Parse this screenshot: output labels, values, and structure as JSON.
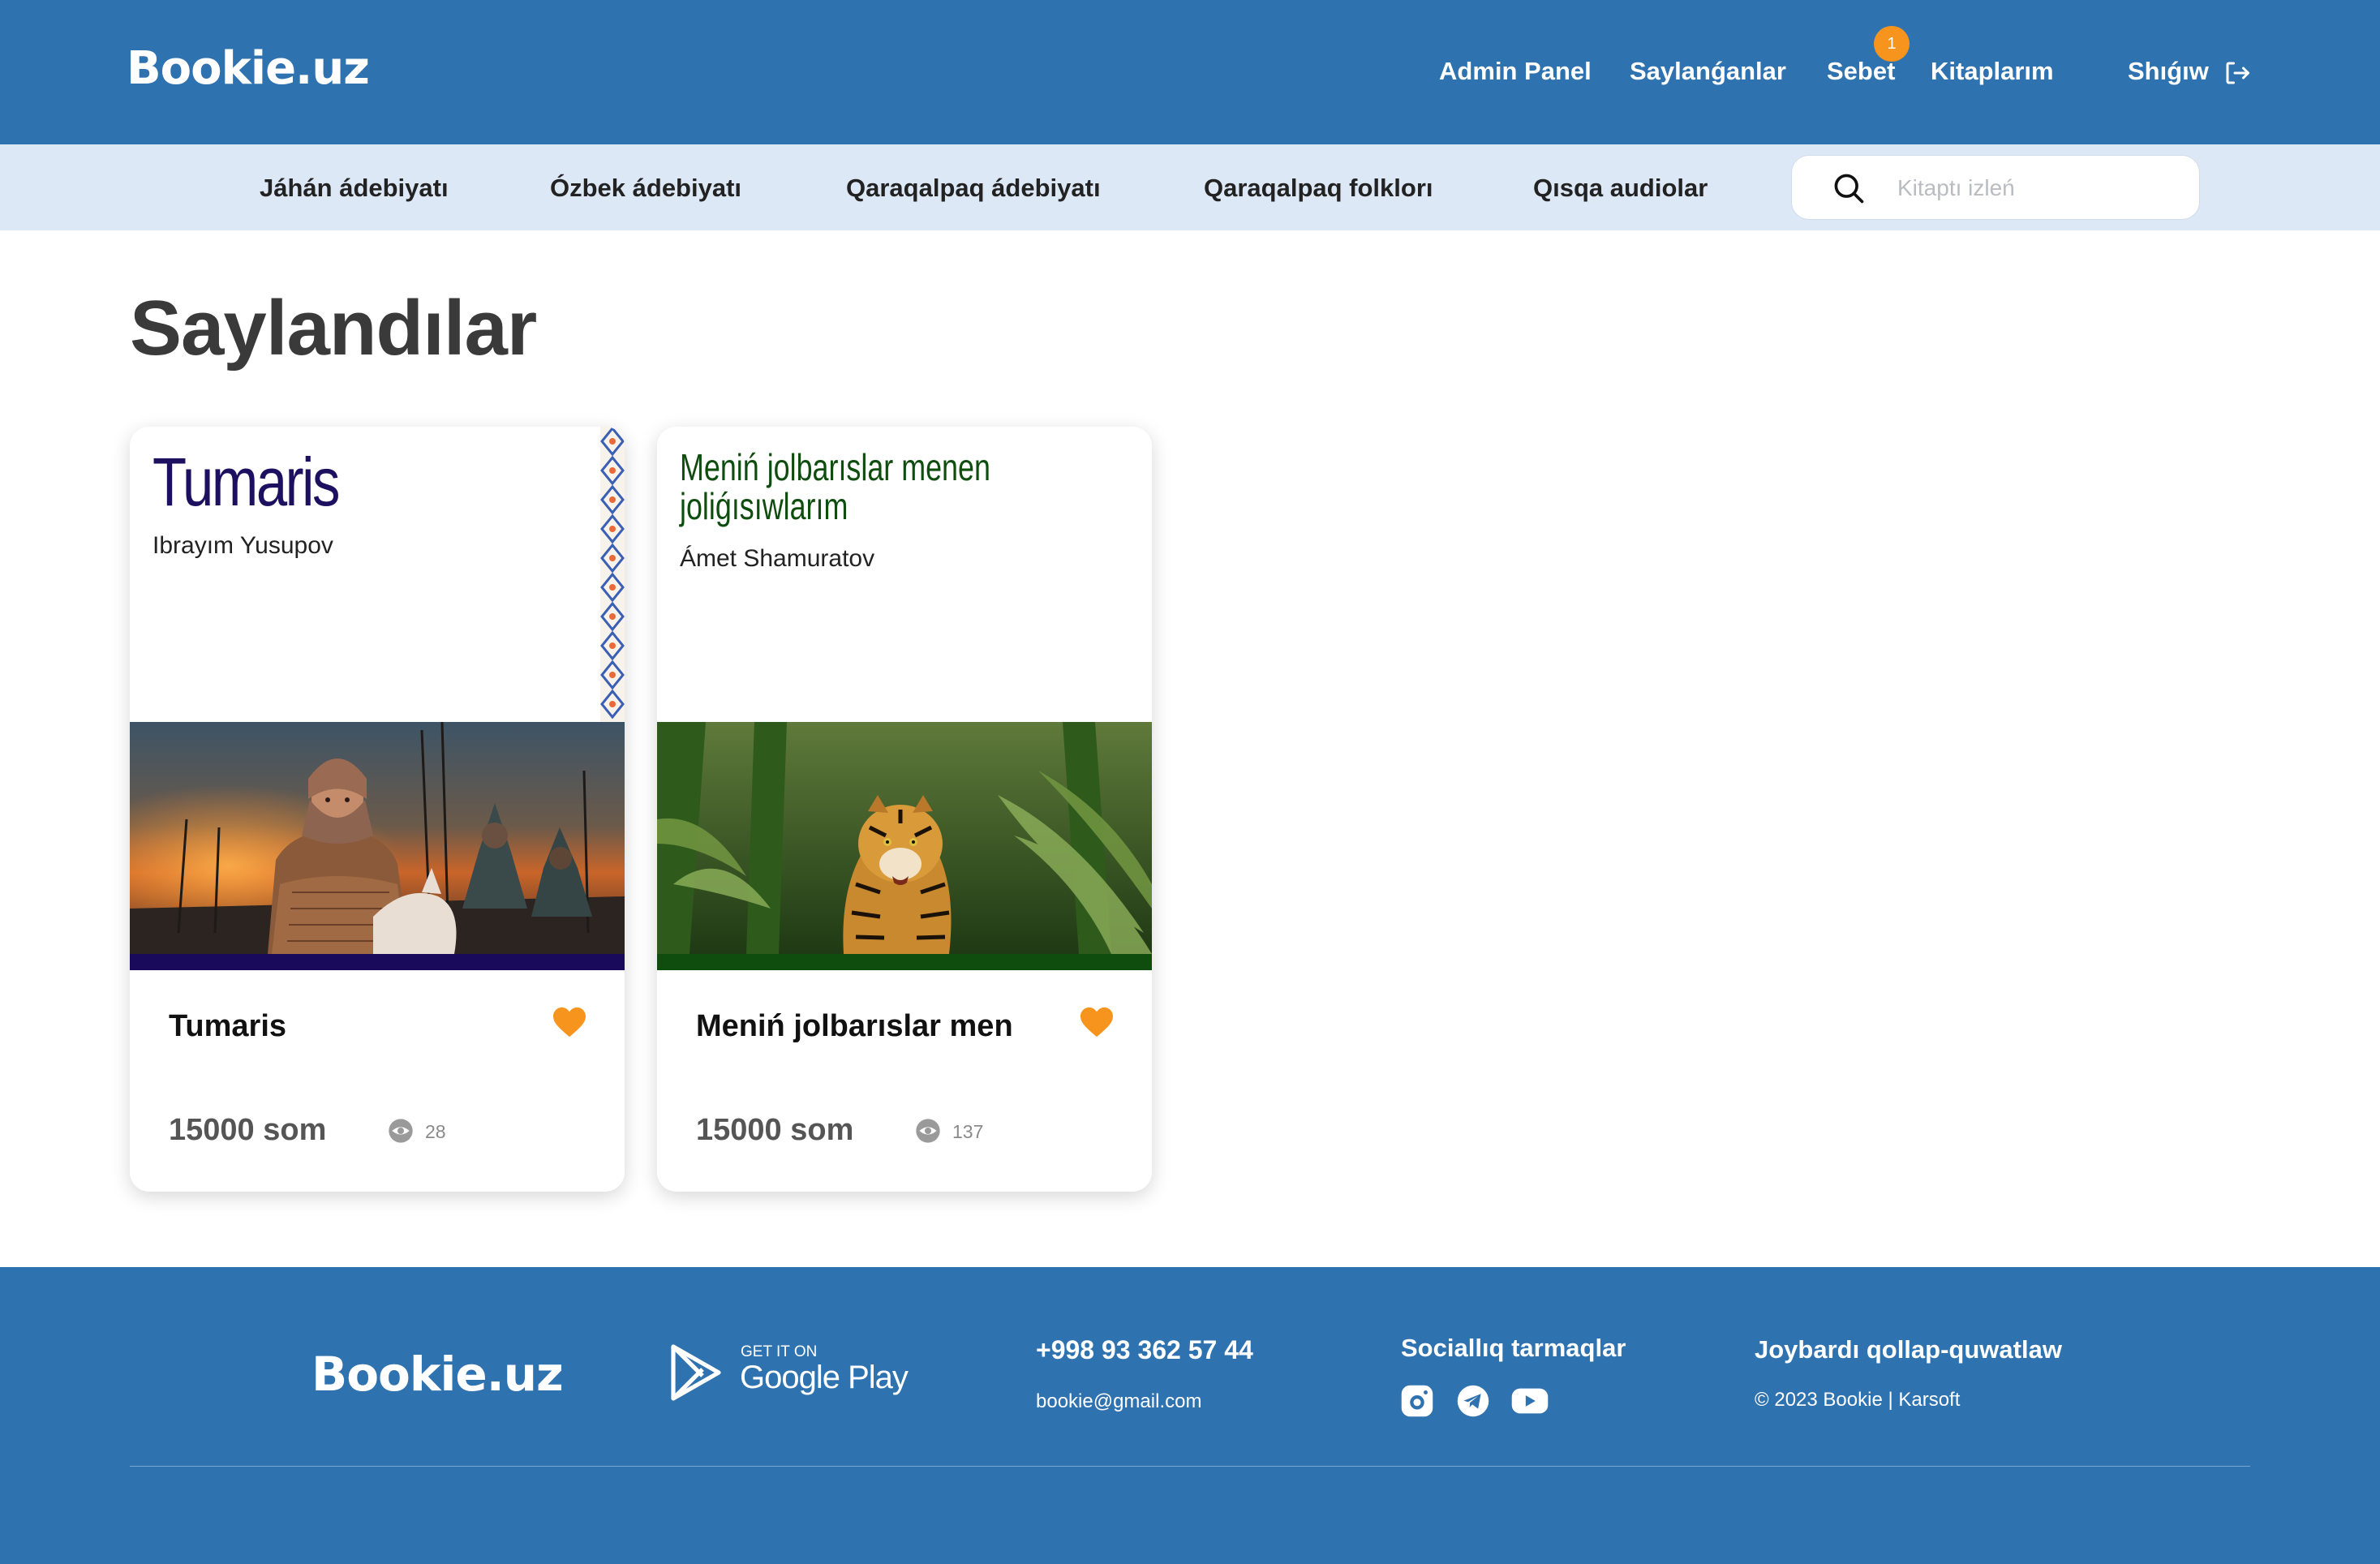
{
  "header": {
    "logo": "Bookie.uz",
    "nav": [
      "Admin Panel",
      "Saylanǵanlar",
      "Sebet",
      "Kitaplarım",
      "Shıǵıw"
    ],
    "cart_count": "1"
  },
  "categories": [
    "Jáhán ádebiyatı",
    "Ózbek ádebiyatı",
    "Qaraqalpaq ádebiyatı",
    "Qaraqalpaq folklorı",
    "Qısqa audiolar"
  ],
  "search": {
    "placeholder": "Kitaptı izleń",
    "value": ""
  },
  "page": {
    "title": "Saylandılar"
  },
  "books": [
    {
      "cover_title": "Tumaris",
      "cover_author": "Ibrayım Yusupov",
      "name": "Tumaris",
      "price": "15000 som",
      "views": "28",
      "accent": "#1a0a5c"
    },
    {
      "cover_title": "Meniń jolbarıslar menen joliǵısıwlarım",
      "cover_author": "Ámet Shamuratov",
      "name": "Meniń jolbarıslar men",
      "price": "15000 som",
      "views": "137",
      "accent": "#0f4d0f"
    }
  ],
  "footer": {
    "logo": "Bookie.uz",
    "store_small": "GET IT ON",
    "store_big": "Google Play",
    "phone": "+998 93 362 57 44",
    "email": "bookie@gmail.com",
    "social_title": "Sociallıq tarmaqlar",
    "support_title": "Joybardı qollap-quwatlaw",
    "copyright": "© 2023 Bookie | Karsoft"
  },
  "colors": {
    "primary": "#2f72b0",
    "subnav": "#dce8f6",
    "heart": "#f7941d",
    "badge": "#f7941d"
  },
  "icons": [
    "logout-icon",
    "search-icon",
    "heart-icon",
    "eye-icon",
    "google-play-icon",
    "instagram-icon",
    "telegram-icon",
    "youtube-icon"
  ]
}
